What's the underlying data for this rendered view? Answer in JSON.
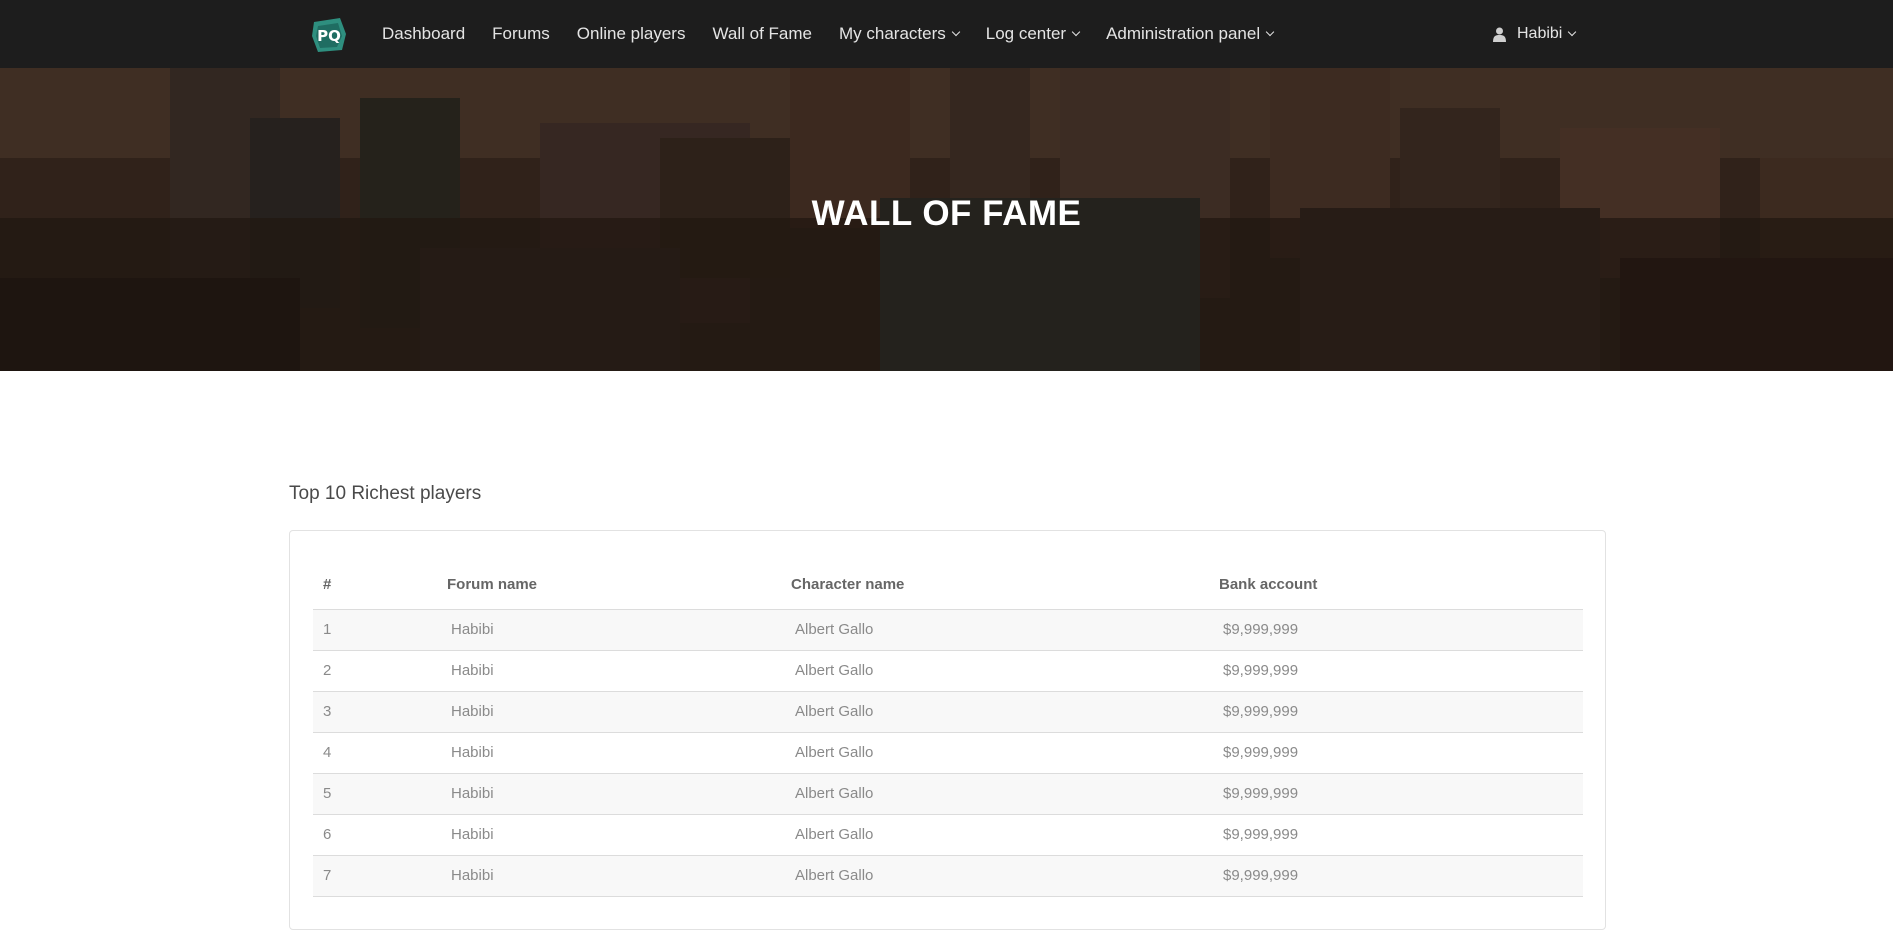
{
  "nav": {
    "logo_alt": "PQ",
    "items": [
      {
        "label": "Dashboard",
        "dropdown": false
      },
      {
        "label": "Forums",
        "dropdown": false
      },
      {
        "label": "Online players",
        "dropdown": false
      },
      {
        "label": "Wall of Fame",
        "dropdown": false
      },
      {
        "label": "My characters",
        "dropdown": true
      },
      {
        "label": "Log center",
        "dropdown": true
      },
      {
        "label": "Administration panel",
        "dropdown": true
      }
    ],
    "user": "Habibi"
  },
  "hero": {
    "title": "WALL OF FAME"
  },
  "section": {
    "title": "Top 10 Richest players"
  },
  "table": {
    "headers": [
      "#",
      "Forum name",
      "Character name",
      "Bank account"
    ],
    "rows": [
      [
        "1",
        "Habibi",
        "Albert Gallo",
        "$9,999,999"
      ],
      [
        "2",
        "Habibi",
        "Albert Gallo",
        "$9,999,999"
      ],
      [
        "3",
        "Habibi",
        "Albert Gallo",
        "$9,999,999"
      ],
      [
        "4",
        "Habibi",
        "Albert Gallo",
        "$9,999,999"
      ],
      [
        "5",
        "Habibi",
        "Albert Gallo",
        "$9,999,999"
      ],
      [
        "6",
        "Habibi",
        "Albert Gallo",
        "$9,999,999"
      ],
      [
        "7",
        "Habibi",
        "Albert Gallo",
        "$9,999,999"
      ]
    ]
  },
  "colors": {
    "navbar": "#1d1d1d",
    "logo_accent": "#2e8f7f",
    "hero_tint": "#4a2e1c"
  }
}
